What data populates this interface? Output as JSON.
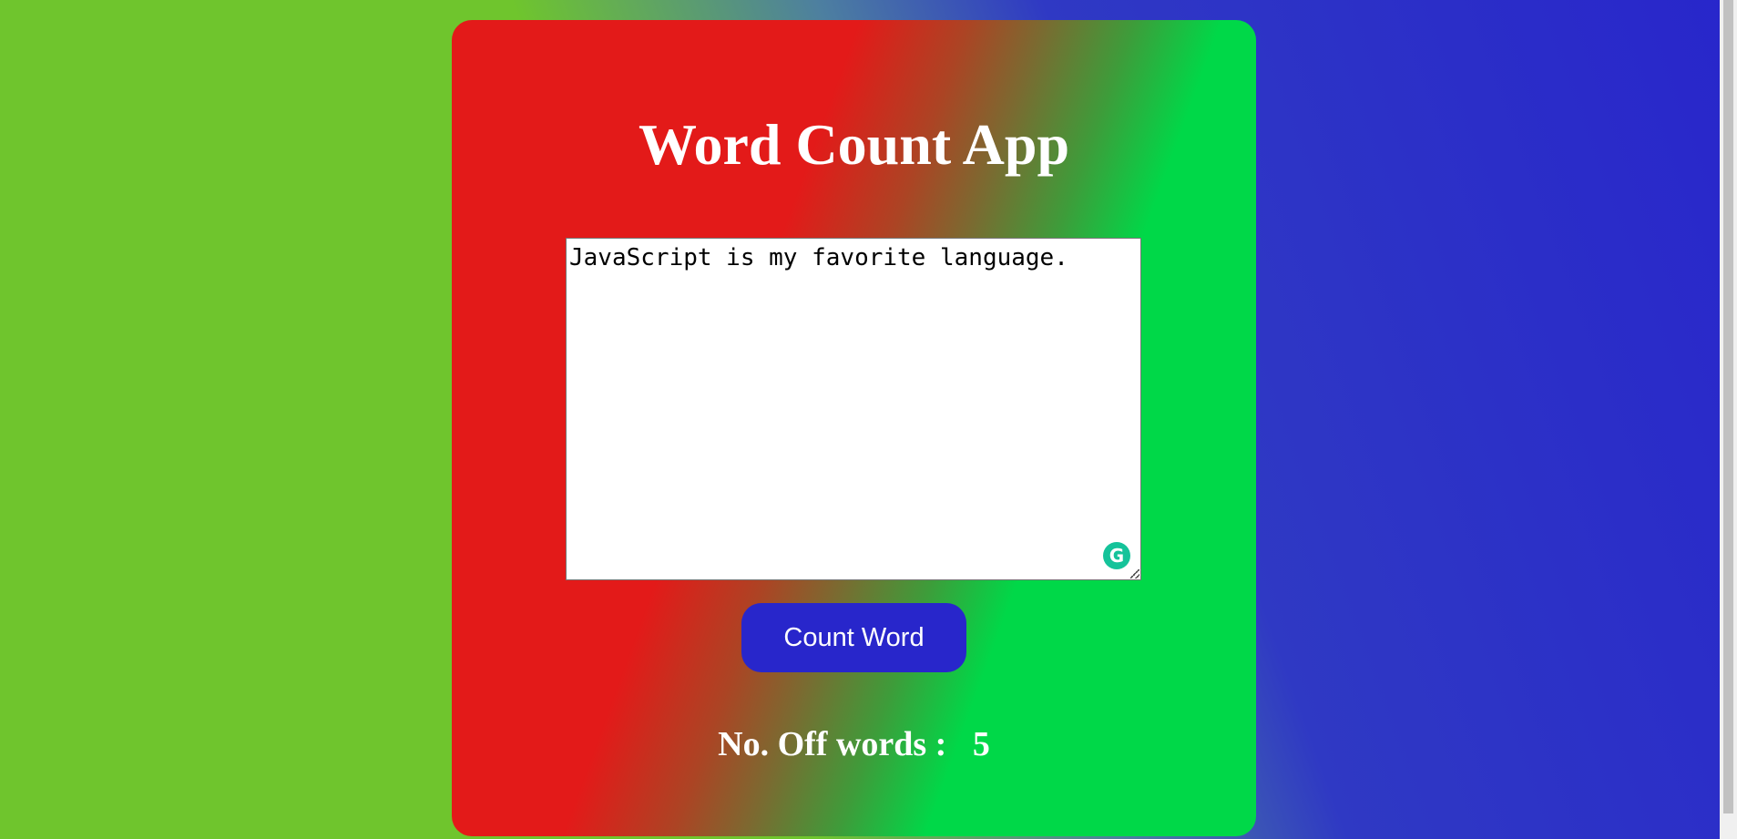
{
  "app": {
    "title": "Word Count App"
  },
  "editor": {
    "value": "JavaScript is my favorite language.",
    "placeholder": "",
    "grammarly_glyph": "G",
    "grammarly_icon": "grammarly-icon"
  },
  "actions": {
    "count_label": "Count Word"
  },
  "result": {
    "label": "No. Off words :",
    "count": "5"
  },
  "colors": {
    "page_left": "#6fc52d",
    "page_right": "#2826cb",
    "card_left": "#e31a19",
    "card_right": "#00d848",
    "button": "#2826cb",
    "text": "#ffffff"
  }
}
